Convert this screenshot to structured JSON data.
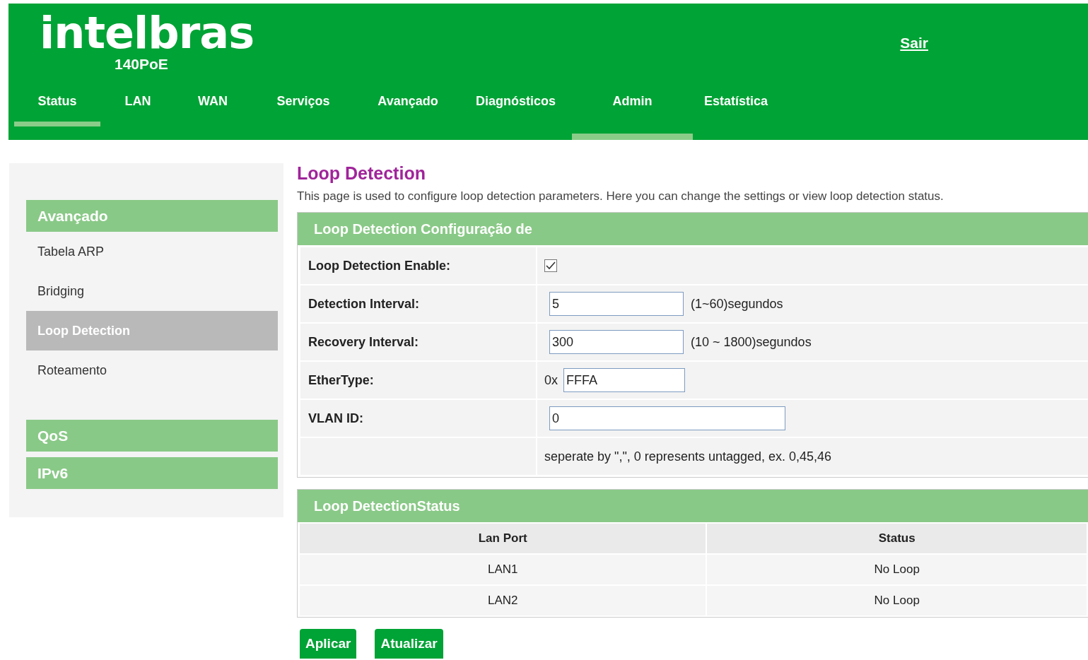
{
  "header": {
    "logo": "intelbras",
    "model": "140PoE",
    "logout": "Sair"
  },
  "nav": [
    {
      "label": "Status",
      "selected": true,
      "highlighted": false
    },
    {
      "label": "LAN",
      "selected": false,
      "highlighted": false
    },
    {
      "label": "WAN",
      "selected": false,
      "highlighted": false
    },
    {
      "label": "Serviços",
      "selected": false,
      "highlighted": false
    },
    {
      "label": "Avançado",
      "selected": false,
      "highlighted": false
    },
    {
      "label": "Diagnósticos",
      "selected": false,
      "highlighted": false
    },
    {
      "label": "Admin",
      "selected": false,
      "highlighted": true
    },
    {
      "label": "Estatística",
      "selected": false,
      "highlighted": false
    }
  ],
  "sidebar": {
    "sections": [
      {
        "title": "Avançado",
        "items": [
          {
            "label": "Tabela ARP",
            "selected": false
          },
          {
            "label": "Bridging",
            "selected": false
          },
          {
            "label": "Loop Detection",
            "selected": true
          },
          {
            "label": "Roteamento",
            "selected": false
          }
        ]
      },
      {
        "title": "QoS"
      },
      {
        "title": "IPv6"
      }
    ]
  },
  "page": {
    "title": "Loop Detection",
    "description": "This page is used to configure loop detection parameters. Here you can change the settings or view loop detection status."
  },
  "config": {
    "title": "Loop Detection Configuração de",
    "rows": [
      {
        "kind": "checkbox",
        "label": "Loop Detection Enable:",
        "checked": true
      },
      {
        "kind": "text",
        "label": "Detection Interval:",
        "value": "5",
        "hint": "(1~60)segundos"
      },
      {
        "kind": "text",
        "label": "Recovery Interval:",
        "value": "300",
        "hint": "(10 ~ 1800)segundos"
      },
      {
        "kind": "prefixed",
        "label": "EtherType:",
        "prefix": "0x",
        "value": "FFFA"
      },
      {
        "kind": "wide",
        "label": "VLAN ID:",
        "value": "0"
      },
      {
        "kind": "note",
        "text": "seperate by \",\", 0 represents untagged, ex. 0,45,46"
      }
    ]
  },
  "status": {
    "title": "Loop DetectionStatus",
    "columns": [
      "Lan Port",
      "Status"
    ],
    "rows": [
      [
        "LAN1",
        "No Loop"
      ],
      [
        "LAN2",
        "No Loop"
      ]
    ]
  },
  "buttons": [
    "Aplicar",
    "Atualizar"
  ]
}
